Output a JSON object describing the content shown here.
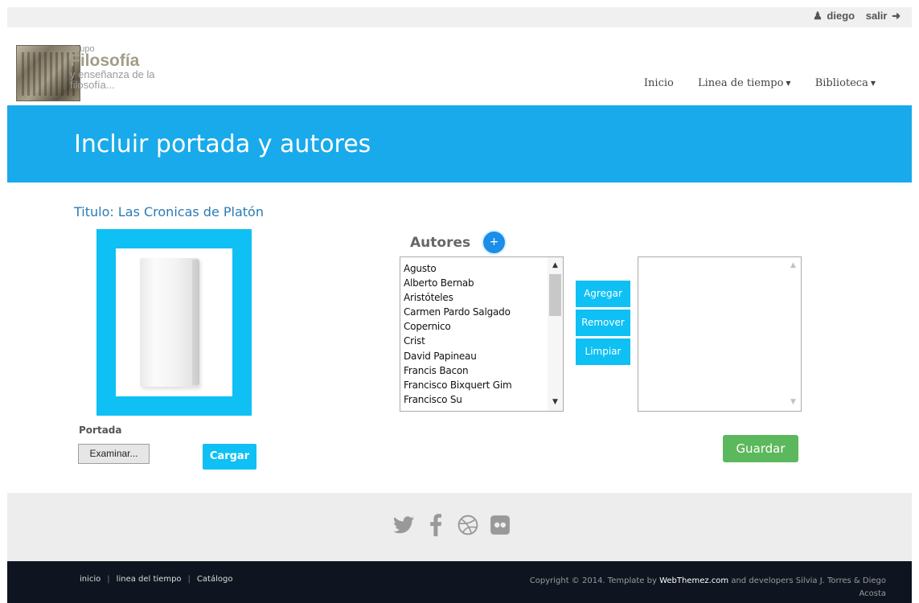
{
  "topbar": {
    "username": "diego",
    "logout_label": "salir"
  },
  "logo": {
    "line1": "Grupo",
    "line2": "Filosofía",
    "line3": "y enseñanza de la",
    "line4": "filosofía..."
  },
  "nav": [
    {
      "label": "Inicio",
      "has_caret": false
    },
    {
      "label": "Linea de tiempo",
      "has_caret": true
    },
    {
      "label": "Biblioteca",
      "has_caret": true
    }
  ],
  "banner": {
    "title": "Incluir portada y autores"
  },
  "book": {
    "title_label": "Titulo: Las Cronicas de Platón"
  },
  "cover": {
    "portada_label": "Portada",
    "file_button": "Examinar...",
    "upload_button": "Cargar"
  },
  "authors": {
    "heading": "Autores",
    "add_icon": "+",
    "available": [
      "Agusto",
      "Alberto Bernab",
      "Aristóteles",
      "Carmen Pardo Salgado",
      "Copernico",
      "Crist",
      "David Papineau",
      "Francis Bacon",
      "Francisco Bixquert Gim",
      "Francisco Su"
    ],
    "selected": [],
    "buttons": {
      "add": "Agregar",
      "remove": "Remover",
      "clear": "Limpiar"
    }
  },
  "save_button": "Guardar",
  "social_icons": [
    "twitter-icon",
    "facebook-icon",
    "dribbble-icon",
    "flickr-icon"
  ],
  "footer": {
    "links": [
      "inicio",
      "linea del tiempo",
      "Catálogo"
    ],
    "copyright_prefix": "Copyright © 2014. Template by",
    "brand": "WebThemez.com",
    "copyright_suffix": "and developers Silvia J. Torres & Diego Acosta"
  },
  "colors": {
    "banner": "#19aaeb",
    "accent": "#0ec0f4",
    "save": "#5cb85c",
    "footer": "#0f1520"
  }
}
